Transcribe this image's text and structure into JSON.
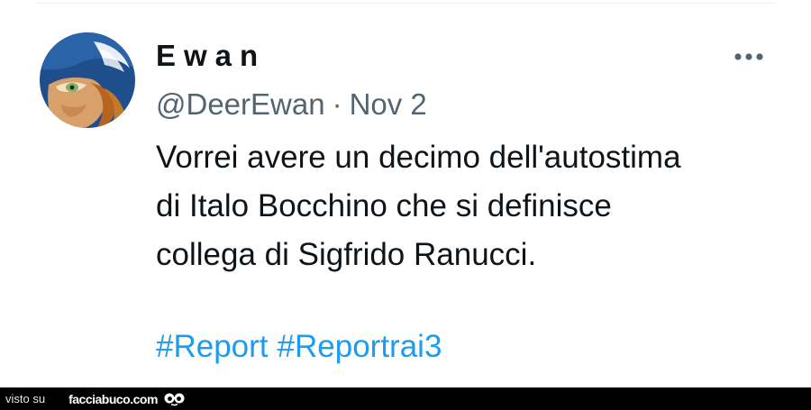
{
  "tweet": {
    "display_name": "Ewan",
    "handle": "@DeerEwan",
    "separator": "·",
    "date": "Nov 2",
    "text_lines": [
      "Vorrei avere un decimo dell'autostima",
      "di Italo Bocchino che si definisce",
      "collega di Sigfrido Ranucci."
    ],
    "hashtags": [
      "#Report",
      "#Reportrai3"
    ],
    "more_icon": "more-horizontal-icon",
    "avatar_icon": "avatar-painting-icon"
  },
  "footer": {
    "prefix": "visto su",
    "site": "facciabuco.com",
    "logo_icon": "googly-eyes-logo-icon"
  },
  "colors": {
    "text": "#0f1419",
    "secondary": "#536471",
    "link": "#1d9bf0",
    "footer_bg": "#000000"
  }
}
